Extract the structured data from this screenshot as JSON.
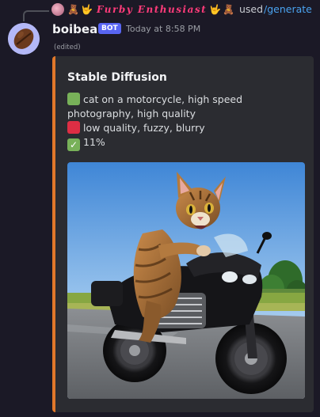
{
  "reply": {
    "user_name": "𝓕𝓾𝓻𝓫𝔂 𝓔𝓷𝓽𝓱𝓾𝓼𝓲𝓪𝓼𝓽",
    "user_name_plain": "Furby Enthusiast",
    "used_text": "used",
    "command": "/generate",
    "emoji_left": [
      "🧸",
      "🤟"
    ],
    "emoji_right": [
      "🤟",
      "🧸"
    ]
  },
  "message": {
    "author": "boibean",
    "bot_tag": "BOT",
    "timestamp": "Today at 8:58 PM",
    "edited": "(edited)",
    "avatar_icon": "coffee-bean-icon"
  },
  "embed": {
    "accent_color": "#e0782a",
    "title": "Stable Diffusion",
    "prompt": "cat on a motorcycle, high speed photography, high quality",
    "negative_prompt": "low quality, fuzzy, blurry",
    "progress": "11%",
    "progress_value": 0.11,
    "image_alt": "cat riding a black motorcycle"
  },
  "colors": {
    "background": "#1b1926",
    "bot_tag": "#5865f2",
    "command_link": "#4aa3f0",
    "reply_name": "#ff3b7a"
  }
}
